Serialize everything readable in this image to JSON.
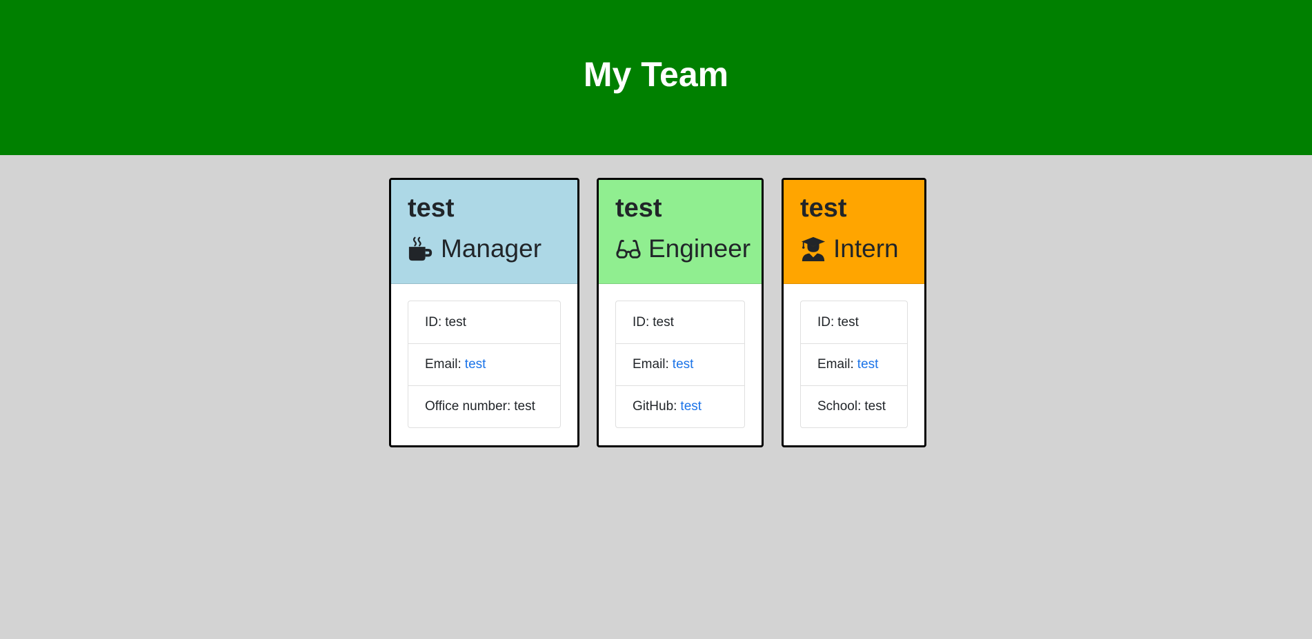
{
  "header": {
    "title": "My Team",
    "background": "#008000"
  },
  "cards": [
    {
      "name": "test",
      "role": "Manager",
      "icon": "mug-icon",
      "header_color": "#add8e6",
      "id_label": "ID:",
      "id_value": "test",
      "email_label": "Email:",
      "email_value": "test",
      "extra_label": "Office number:",
      "extra_value": "test"
    },
    {
      "name": "test",
      "role": "Engineer",
      "icon": "glasses-icon",
      "header_color": "#90ee90",
      "id_label": "ID:",
      "id_value": "test",
      "email_label": "Email:",
      "email_value": "test",
      "extra_label": "GitHub:",
      "extra_value": "test"
    },
    {
      "name": "test",
      "role": "Intern",
      "icon": "graduate-icon",
      "header_color": "#ffa500",
      "id_label": "ID:",
      "id_value": "test",
      "email_label": "Email:",
      "email_value": "test",
      "extra_label": "School:",
      "extra_value": "test"
    }
  ],
  "colors": {
    "page_background": "#d3d3d3",
    "link": "#1a73e8"
  }
}
